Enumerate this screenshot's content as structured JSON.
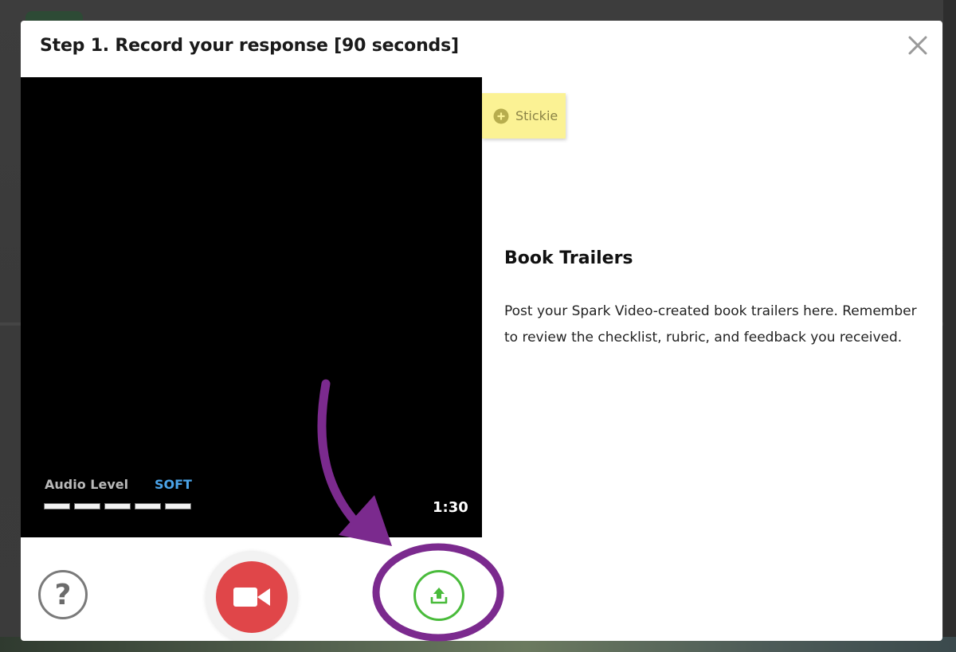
{
  "modal": {
    "title": "Step 1. Record your response [90 seconds]",
    "close_icon": "close-icon"
  },
  "video": {
    "audio_level_label": "Audio Level",
    "audio_level_status": "SOFT",
    "audio_meter_segments": 5,
    "timer": "1:30"
  },
  "stickie": {
    "icon": "plus-circle-icon",
    "label": "Stickie"
  },
  "prompt": {
    "title": "Book Trailers",
    "body": "Post your Spark Video-created book trailers here. Remember to review the checklist, rubric, and feedback you received."
  },
  "controls": {
    "help_label": "?",
    "record_icon": "video-camera-icon",
    "upload_icon": "upload-icon"
  },
  "colors": {
    "record_red": "#e04649",
    "upload_green": "#49bb3b",
    "annotation_purple": "#7b2a8e",
    "audio_status_blue": "#4aa3e8",
    "stickie_yellow": "#fbf294"
  }
}
